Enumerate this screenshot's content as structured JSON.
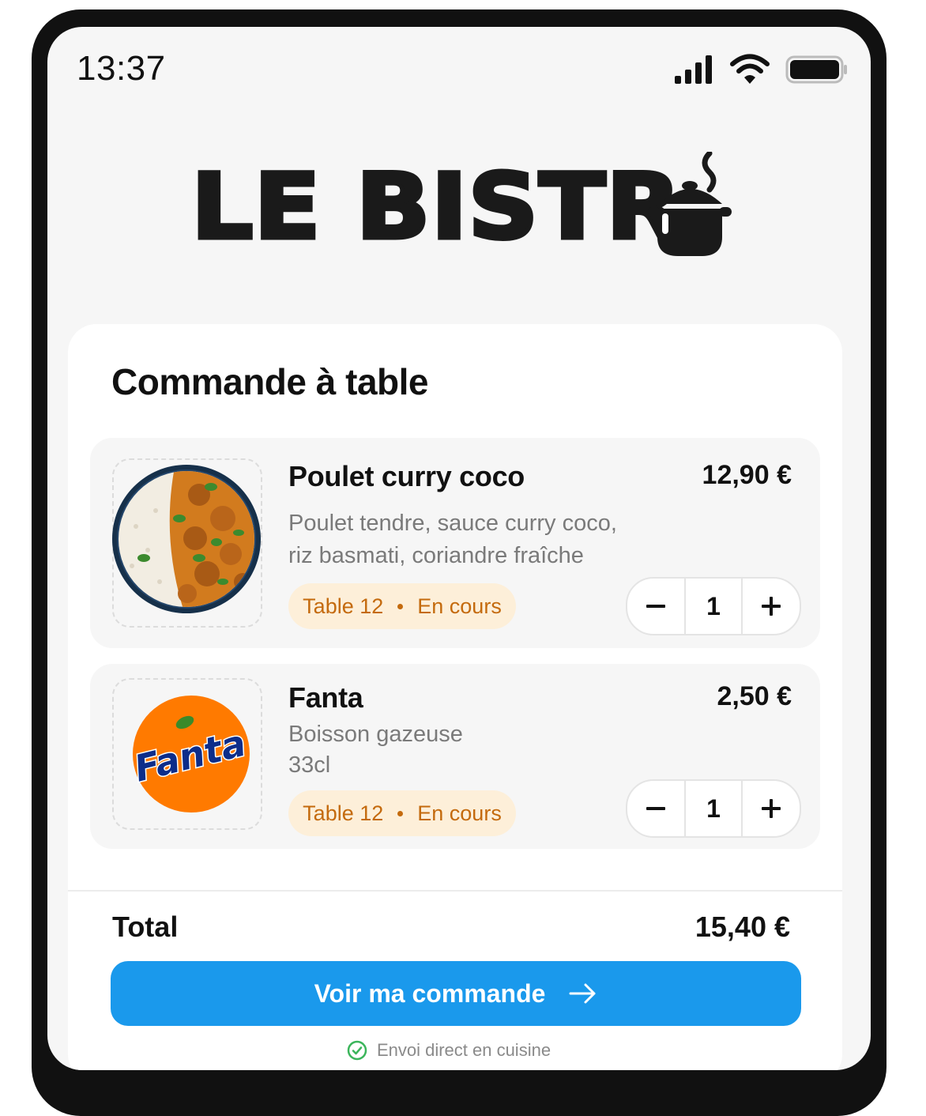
{
  "status_bar": {
    "time": "13:37"
  },
  "brand": {
    "logo_text": "LE BISTR"
  },
  "order": {
    "title": "Commande à table",
    "items": [
      {
        "name": "Poulet curry coco",
        "price": "12,90 €",
        "description": [
          "Poulet tendre, sauce curry coco,",
          "riz basmati, coriandre fraîche"
        ],
        "table": "Table 12",
        "status": "En cours",
        "quantity": "1",
        "image": "poulet-curry-photo"
      },
      {
        "name": "Fanta",
        "price": "2,50 €",
        "description": [
          "Boisson gazeuse",
          "33cl"
        ],
        "table": "Table 12",
        "status": "En cours",
        "quantity": "1",
        "image": "fanta-logo",
        "image_text": "Fanta"
      }
    ],
    "total_label": "Total",
    "total_value": "15,40 €",
    "cta_label": "Voir ma commande",
    "note": "Envoi direct en cuisine"
  },
  "colors": {
    "accent": "#1a99ec",
    "badge_bg": "#fdefd9",
    "badge_text": "#c46a0d",
    "success": "#3bb55b"
  },
  "icons": [
    "signal-icon",
    "wifi-icon",
    "battery-icon",
    "cooking-pot-icon",
    "minus-icon",
    "plus-icon",
    "arrow-right-icon",
    "check-circle-icon"
  ]
}
